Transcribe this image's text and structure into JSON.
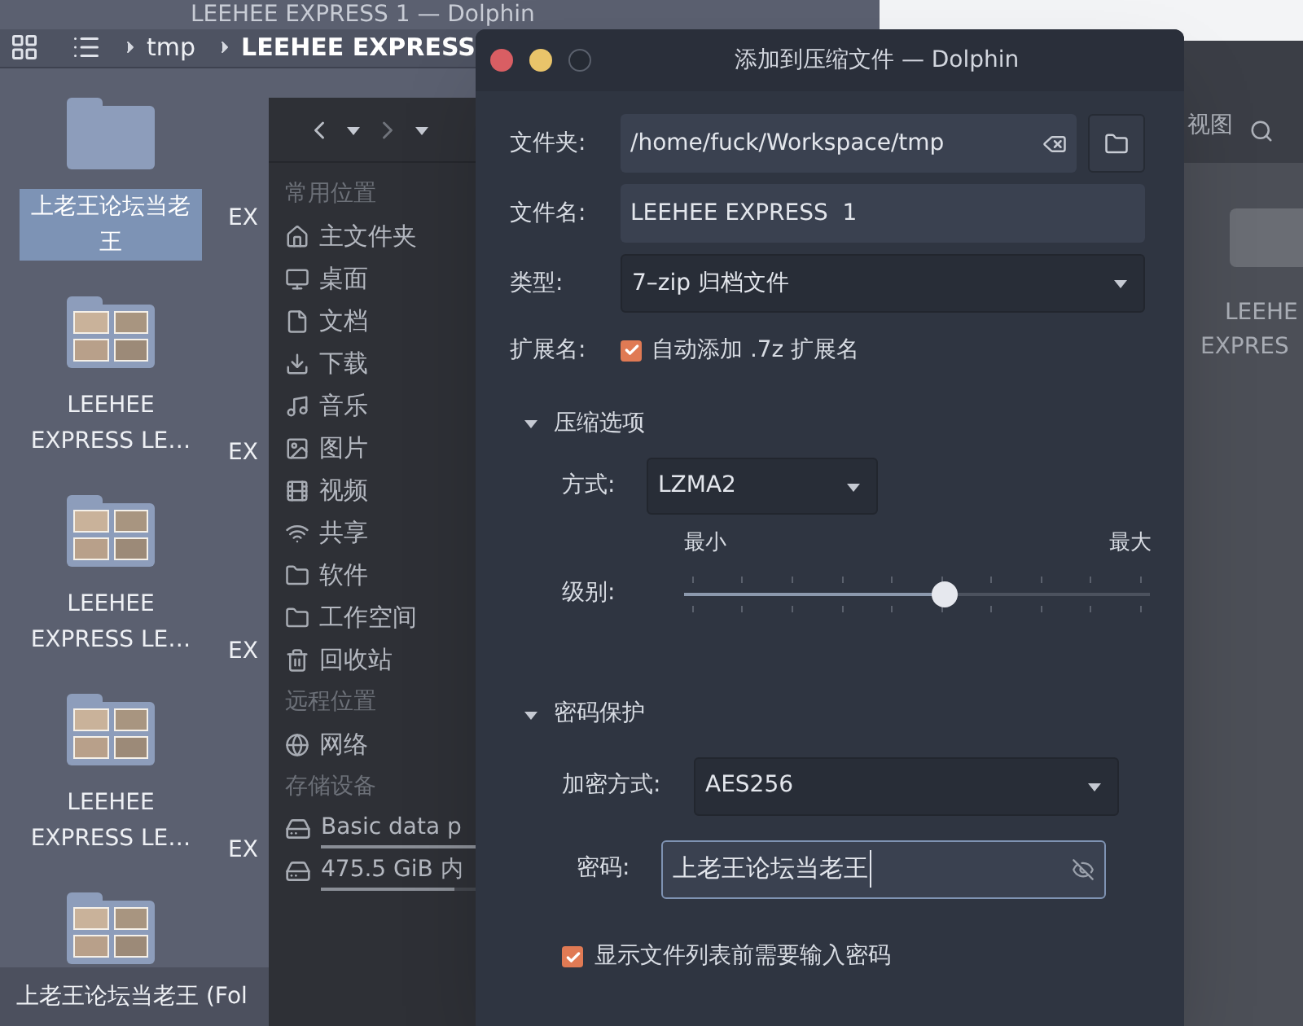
{
  "file_window": {
    "title": "LEEHEE EXPRESS 1 — Dolphin",
    "breadcrumb": [
      "tmp",
      "LEEHEE EXPRESS"
    ],
    "items": [
      {
        "kind": "plain",
        "label": "上老王论坛当老王",
        "selected": true
      },
      {
        "kind": "thumbnails",
        "label": "LEEHEE EXPRESS  LE…",
        "selected": false
      },
      {
        "kind": "thumbnails",
        "label": "LEEHEE EXPRESS  LE…",
        "selected": false
      },
      {
        "kind": "thumbnails",
        "label": "LEEHEE EXPRESS  LE…",
        "selected": false
      },
      {
        "kind": "thumbnails"
      }
    ],
    "column_2": [
      "EX",
      "EX",
      "EX",
      "EX"
    ],
    "status_bar": "上老王论坛当老王 (Fol"
  },
  "places_window": {
    "sections": [
      {
        "title": "常用位置",
        "items": [
          "主文件夹",
          "桌面",
          "文档",
          "下载",
          "音乐",
          "图片",
          "视频",
          "共享",
          "软件",
          "工作空间",
          "回收站"
        ]
      },
      {
        "title": "远程位置",
        "items": [
          "网络"
        ]
      },
      {
        "title": "存储设备",
        "devices": [
          {
            "label": "Basic data p",
            "level": 1
          },
          {
            "label": "475.5 GiB 内",
            "level": 0.86
          }
        ]
      }
    ]
  },
  "side_window": {
    "toolbar_label": "视图",
    "folder_label": [
      "LEEHE",
      "EXPRES"
    ]
  },
  "dialog": {
    "title": "添加到压缩文件 — Dolphin",
    "folder": {
      "label": "文件夹:",
      "value": "/home/fuck/Workspace/tmp"
    },
    "filename": {
      "label": "文件名:",
      "value": "LEEHEE EXPRESS  1"
    },
    "type": {
      "label": "类型:",
      "value": "7–zip 归档文件"
    },
    "extension": {
      "label": "扩展名:",
      "text": "自动添加 .7z 扩展名",
      "checked": true
    },
    "compression": {
      "title": "压缩选项",
      "expanded": true,
      "method_label": "方式:",
      "method": "LZMA2",
      "min": "最小",
      "max": "最大",
      "level_label": "级别:",
      "level": 0.56
    },
    "password": {
      "title": "密码保护",
      "expanded": true,
      "encryption_label": "加密方式:",
      "encryption": "AES256",
      "password_label": "密码:",
      "password": "上老王论坛当老王",
      "ask_label": "显示文件列表前需要输入密码",
      "ask_checked": true
    }
  }
}
